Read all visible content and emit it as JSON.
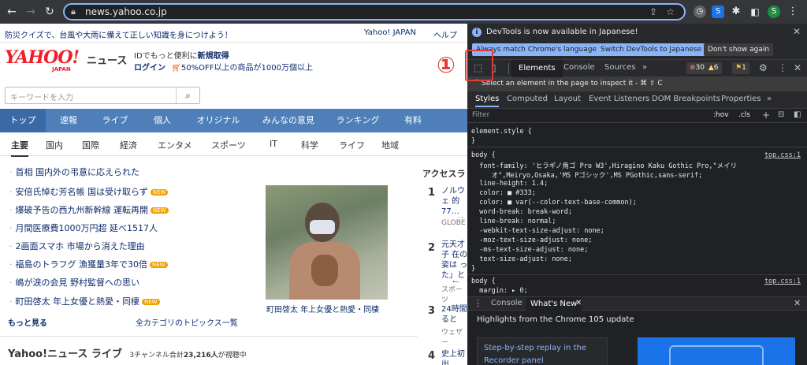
{
  "browser": {
    "url": "news.yahoo.co.jp",
    "profile_initial": "S"
  },
  "page": {
    "topbar": {
      "notice": "防災クイズで、台風や大雨に備えて正しい知識を身につけよう！",
      "yahoo_japan": "Yahoo! JAPAN",
      "help": "ヘルプ"
    },
    "logo": {
      "wordmark": "YAHOO!",
      "sub": "JAPAN",
      "news": "ニュース"
    },
    "promo": {
      "line1_a": "IDでもっと便利に",
      "line1_b": "新規取得",
      "line2_login": "ログイン",
      "line2_b": "50%OFF以上の商品が1000万個以上"
    },
    "search": {
      "placeholder": "キーワードを入力"
    },
    "global_nav": [
      "トップ",
      "速報",
      "ライブ",
      "個人",
      "オリジナル",
      "みんなの意見",
      "ランキング",
      "有料"
    ],
    "sub_nav": [
      "主要",
      "国内",
      "国際",
      "経済",
      "エンタメ",
      "スポーツ",
      "IT",
      "科学",
      "ライフ",
      "地域"
    ],
    "topics": [
      {
        "text": "首相 国内外の弔意に応えられた",
        "new": false
      },
      {
        "text": "安倍氏悼む芳名帳 国は受け取らず",
        "new": true
      },
      {
        "text": "爆破予告の西九州新幹線 運転再開",
        "new": true
      },
      {
        "text": "月間医療費1000万円超 延べ1517人",
        "new": false
      },
      {
        "text": "2画面スマホ 市場から消えた理由",
        "new": false
      },
      {
        "text": "福島のトラフグ 漁獲量3年で30倍",
        "new": true
      },
      {
        "text": "嶋が涙の会見 野村監督への思い",
        "new": false
      },
      {
        "text": "町田啓太 年上女優と熱愛・同棲",
        "new": true
      }
    ],
    "new_badge": "NEW",
    "more_link": "もっと見る",
    "all_categories": "全カテゴリのトピックス一覧",
    "photo_caption": "町田啓太 年上女優と熱愛・同棲",
    "access_ranking": {
      "title": "アクセスラ",
      "items": [
        {
          "rank": "1",
          "text": "ノルウェ 的 77… ム…検",
          "source": "GLOBE"
        },
        {
          "rank": "2",
          "text": "元天才子 在の姿は った」と 18年",
          "source": "スポーツ"
        },
        {
          "rank": "3",
          "text": "24時間 ると「台",
          "source": "ウェザー"
        },
        {
          "rank": "4",
          "text": "史上初 出",
          "source": ""
        }
      ]
    },
    "live": {
      "title": "Yahoo!ニュース ライブ",
      "info_a": "3チャンネル合計",
      "info_b": "23,216人",
      "info_c": "が視聴中"
    }
  },
  "devtools": {
    "banner_text": "DevTools is now available in Japanese!",
    "banner_buttons": [
      "Always match Chrome's language",
      "Switch DevTools to Japanese",
      "Don't show again"
    ],
    "main_tabs": [
      "Elements",
      "Console",
      "Sources"
    ],
    "errors": "30",
    "warnings": "6",
    "issues": "1",
    "tooltip": "Select an element in the page to inspect it - ⌘ ⇧ C",
    "style_tabs": [
      "Styles",
      "Computed",
      "Layout",
      "Event Listeners",
      "DOM Breakpoints",
      "Properties"
    ],
    "filter_placeholder": "Filter",
    "filter_hov": ":hov",
    "filter_cls": ".cls",
    "css_lines": [
      "element.style {",
      "}",
      "body {",
      "  font-family: 'ヒラギノ角ゴ Pro W3',Hiragino Kaku Gothic Pro,\"メイリ",
      "     オ\",Meiryo,Osaka,'MS Pゴシック',MS PGothic,sans-serif;",
      "  line-height: 1.4;",
      "  color: ■ #333;",
      "  color: ■ var(--color-text-base-common);",
      "  word-break: break-word;",
      "  line-break: normal;",
      "  -webkit-text-size-adjust: none;",
      "  -moz-text-size-adjust: none;",
      "  -ms-text-size-adjust: none;",
      "  text-size-adjust: none;",
      "}",
      "body {",
      "  margin: ▸ 0;",
      "}"
    ],
    "css_source": "top.css:1",
    "drawer_tabs": [
      "Console",
      "What's New"
    ],
    "whats_new_heading": "Highlights from the Chrome 105 update",
    "whats_new_card": "Step-by-step replay in the Recorder panel"
  },
  "annotation": {
    "marker": "①",
    "color": "#e53935"
  }
}
